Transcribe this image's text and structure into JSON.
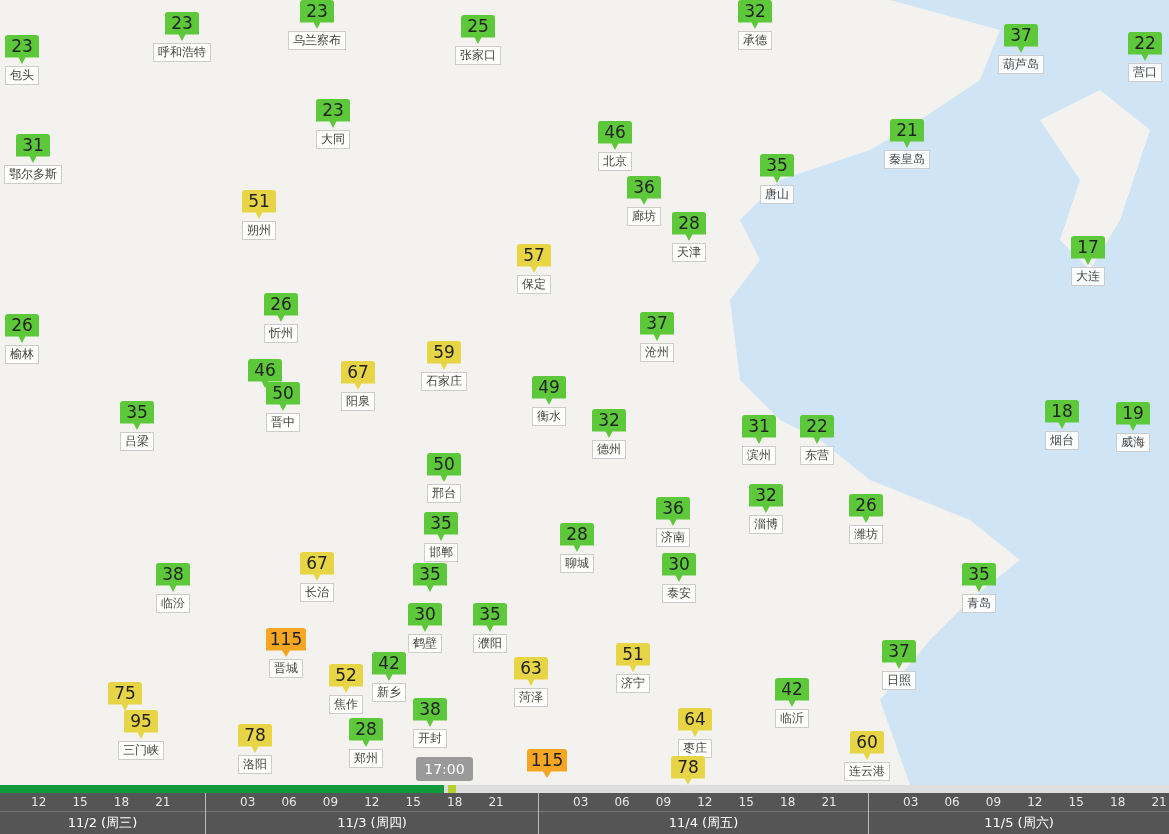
{
  "markers": [
    {
      "value": "23",
      "label": "包头",
      "color": "#5cc83a"
    },
    {
      "value": "23",
      "label": "呼和浩特",
      "color": "#5cc83a"
    },
    {
      "value": "23",
      "label": "乌兰察布",
      "color": "#5cc83a"
    },
    {
      "value": "25",
      "label": "张家口",
      "color": "#5cc83a"
    },
    {
      "value": "32",
      "label": "承德",
      "color": "#5cc83a"
    },
    {
      "value": "37",
      "label": "葫芦岛",
      "color": "#5cc83a"
    },
    {
      "value": "22",
      "label": "营口",
      "color": "#5cc83a"
    },
    {
      "value": "31",
      "label": "鄂尔多斯",
      "color": "#5cc83a"
    },
    {
      "value": "23",
      "label": "大同",
      "color": "#5cc83a"
    },
    {
      "value": "46",
      "label": "北京",
      "color": "#5cc83a"
    },
    {
      "value": "21",
      "label": "秦皇岛",
      "color": "#5cc83a"
    },
    {
      "value": "36",
      "label": "廊坊",
      "color": "#5cc83a"
    },
    {
      "value": "35",
      "label": "唐山",
      "color": "#5cc83a"
    },
    {
      "value": "51",
      "label": "朔州",
      "color": "#e8d545"
    },
    {
      "value": "28",
      "label": "天津",
      "color": "#5cc83a"
    },
    {
      "value": "57",
      "label": "保定",
      "color": "#e8d545"
    },
    {
      "value": "17",
      "label": "大连",
      "color": "#5cc83a"
    },
    {
      "value": "26",
      "label": "榆林",
      "color": "#5cc83a"
    },
    {
      "value": "26",
      "label": "忻州",
      "color": "#5cc83a"
    },
    {
      "value": "37",
      "label": "沧州",
      "color": "#5cc83a"
    },
    {
      "value": "46",
      "color": "#5cc83a"
    },
    {
      "value": "50",
      "label": "晋中",
      "color": "#5cc83a"
    },
    {
      "value": "67",
      "label": "阳泉",
      "color": "#e8d545"
    },
    {
      "value": "59",
      "label": "石家庄",
      "color": "#e8d545"
    },
    {
      "value": "49",
      "label": "衡水",
      "color": "#5cc83a"
    },
    {
      "value": "35",
      "label": "吕梁",
      "color": "#5cc83a"
    },
    {
      "value": "32",
      "label": "德州",
      "color": "#5cc83a"
    },
    {
      "value": "31",
      "label": "滨州",
      "color": "#5cc83a"
    },
    {
      "value": "22",
      "label": "东营",
      "color": "#5cc83a"
    },
    {
      "value": "18",
      "label": "烟台",
      "color": "#5cc83a"
    },
    {
      "value": "19",
      "label": "威海",
      "color": "#5cc83a"
    },
    {
      "value": "50",
      "label": "邢台",
      "color": "#5cc83a"
    },
    {
      "value": "35",
      "label": "邯郸",
      "color": "#5cc83a"
    },
    {
      "value": "28",
      "label": "聊城",
      "color": "#5cc83a"
    },
    {
      "value": "36",
      "label": "济南",
      "color": "#5cc83a"
    },
    {
      "value": "32",
      "label": "淄博",
      "color": "#5cc83a"
    },
    {
      "value": "26",
      "label": "潍坊",
      "color": "#5cc83a"
    },
    {
      "value": "38",
      "label": "临汾",
      "color": "#5cc83a"
    },
    {
      "value": "67",
      "label": "长治",
      "color": "#e8d545"
    },
    {
      "value": "35",
      "color": "#5cc83a"
    },
    {
      "value": "30",
      "label": "泰安",
      "color": "#5cc83a"
    },
    {
      "value": "35",
      "label": "青岛",
      "color": "#5cc83a"
    },
    {
      "value": "30",
      "label": "鹤壁",
      "color": "#5cc83a"
    },
    {
      "value": "35",
      "label": "濮阳",
      "color": "#5cc83a"
    },
    {
      "value": "115",
      "label": "晋城",
      "color": "#f5a623"
    },
    {
      "value": "52",
      "label": "焦作",
      "color": "#e8d545"
    },
    {
      "value": "42",
      "label": "新乡",
      "color": "#5cc83a"
    },
    {
      "value": "63",
      "label": "菏泽",
      "color": "#e8d545"
    },
    {
      "value": "51",
      "label": "济宁",
      "color": "#e8d545"
    },
    {
      "value": "37",
      "label": "日照",
      "color": "#5cc83a"
    },
    {
      "value": "75",
      "color": "#e8d545"
    },
    {
      "value": "42",
      "label": "临沂",
      "color": "#5cc83a"
    },
    {
      "value": "95",
      "label": "三门峡",
      "color": "#e8d545"
    },
    {
      "value": "78",
      "label": "洛阳",
      "color": "#e8d545"
    },
    {
      "value": "28",
      "label": "郑州",
      "color": "#5cc83a"
    },
    {
      "value": "38",
      "label": "开封",
      "color": "#5cc83a"
    },
    {
      "value": "115",
      "color": "#f5a623"
    },
    {
      "value": "64",
      "label": "枣庄",
      "color": "#e8d545"
    },
    {
      "value": "78",
      "color": "#e8d545"
    },
    {
      "value": "60",
      "label": "连云港",
      "color": "#e8d545"
    }
  ],
  "timeline": {
    "level": 0.38,
    "current_time": "17:00",
    "days": [
      {
        "label": "11/2 (周三)",
        "hours": [
          "12",
          "15",
          "18",
          "21"
        ]
      },
      {
        "label": "11/3 (周四)",
        "hours": [
          "03",
          "06",
          "09",
          "12",
          "15",
          "18",
          "21"
        ]
      },
      {
        "label": "11/4 (周五)",
        "hours": [
          "03",
          "06",
          "09",
          "12",
          "15",
          "18",
          "21"
        ]
      },
      {
        "label": "11/5 (周六)",
        "hours": [
          "03",
          "06",
          "09",
          "12",
          "15",
          "18",
          "21"
        ]
      }
    ]
  }
}
